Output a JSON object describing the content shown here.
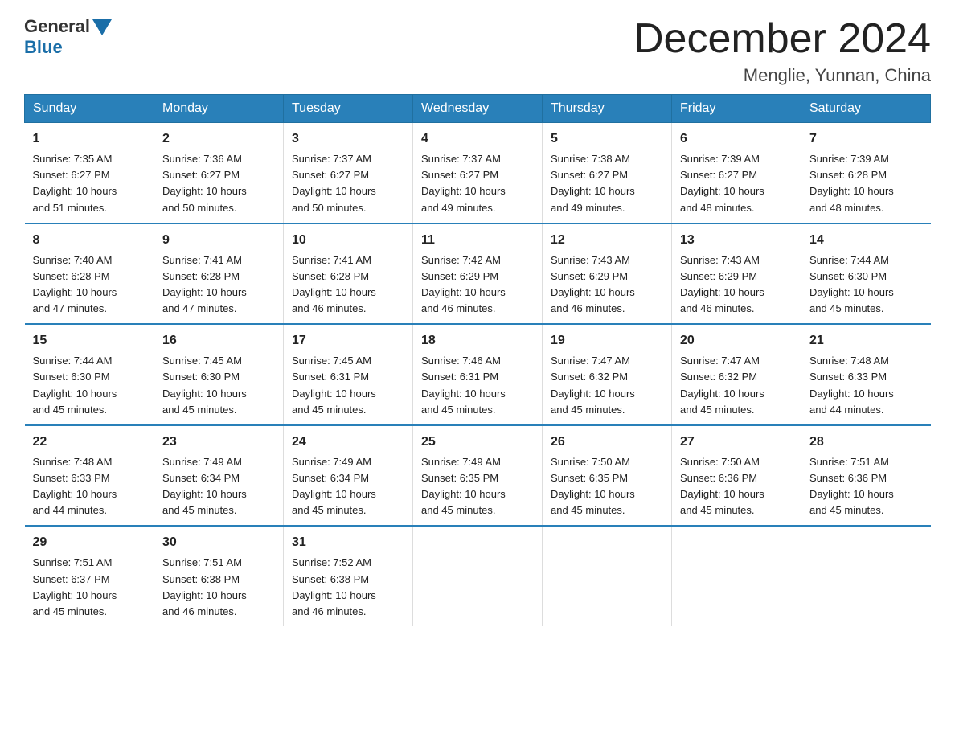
{
  "logo": {
    "general": "General",
    "blue": "Blue"
  },
  "title": "December 2024",
  "location": "Menglie, Yunnan, China",
  "headers": [
    "Sunday",
    "Monday",
    "Tuesday",
    "Wednesday",
    "Thursday",
    "Friday",
    "Saturday"
  ],
  "rows": [
    [
      {
        "day": "1",
        "info": "Sunrise: 7:35 AM\nSunset: 6:27 PM\nDaylight: 10 hours\nand 51 minutes."
      },
      {
        "day": "2",
        "info": "Sunrise: 7:36 AM\nSunset: 6:27 PM\nDaylight: 10 hours\nand 50 minutes."
      },
      {
        "day": "3",
        "info": "Sunrise: 7:37 AM\nSunset: 6:27 PM\nDaylight: 10 hours\nand 50 minutes."
      },
      {
        "day": "4",
        "info": "Sunrise: 7:37 AM\nSunset: 6:27 PM\nDaylight: 10 hours\nand 49 minutes."
      },
      {
        "day": "5",
        "info": "Sunrise: 7:38 AM\nSunset: 6:27 PM\nDaylight: 10 hours\nand 49 minutes."
      },
      {
        "day": "6",
        "info": "Sunrise: 7:39 AM\nSunset: 6:27 PM\nDaylight: 10 hours\nand 48 minutes."
      },
      {
        "day": "7",
        "info": "Sunrise: 7:39 AM\nSunset: 6:28 PM\nDaylight: 10 hours\nand 48 minutes."
      }
    ],
    [
      {
        "day": "8",
        "info": "Sunrise: 7:40 AM\nSunset: 6:28 PM\nDaylight: 10 hours\nand 47 minutes."
      },
      {
        "day": "9",
        "info": "Sunrise: 7:41 AM\nSunset: 6:28 PM\nDaylight: 10 hours\nand 47 minutes."
      },
      {
        "day": "10",
        "info": "Sunrise: 7:41 AM\nSunset: 6:28 PM\nDaylight: 10 hours\nand 46 minutes."
      },
      {
        "day": "11",
        "info": "Sunrise: 7:42 AM\nSunset: 6:29 PM\nDaylight: 10 hours\nand 46 minutes."
      },
      {
        "day": "12",
        "info": "Sunrise: 7:43 AM\nSunset: 6:29 PM\nDaylight: 10 hours\nand 46 minutes."
      },
      {
        "day": "13",
        "info": "Sunrise: 7:43 AM\nSunset: 6:29 PM\nDaylight: 10 hours\nand 46 minutes."
      },
      {
        "day": "14",
        "info": "Sunrise: 7:44 AM\nSunset: 6:30 PM\nDaylight: 10 hours\nand 45 minutes."
      }
    ],
    [
      {
        "day": "15",
        "info": "Sunrise: 7:44 AM\nSunset: 6:30 PM\nDaylight: 10 hours\nand 45 minutes."
      },
      {
        "day": "16",
        "info": "Sunrise: 7:45 AM\nSunset: 6:30 PM\nDaylight: 10 hours\nand 45 minutes."
      },
      {
        "day": "17",
        "info": "Sunrise: 7:45 AM\nSunset: 6:31 PM\nDaylight: 10 hours\nand 45 minutes."
      },
      {
        "day": "18",
        "info": "Sunrise: 7:46 AM\nSunset: 6:31 PM\nDaylight: 10 hours\nand 45 minutes."
      },
      {
        "day": "19",
        "info": "Sunrise: 7:47 AM\nSunset: 6:32 PM\nDaylight: 10 hours\nand 45 minutes."
      },
      {
        "day": "20",
        "info": "Sunrise: 7:47 AM\nSunset: 6:32 PM\nDaylight: 10 hours\nand 45 minutes."
      },
      {
        "day": "21",
        "info": "Sunrise: 7:48 AM\nSunset: 6:33 PM\nDaylight: 10 hours\nand 44 minutes."
      }
    ],
    [
      {
        "day": "22",
        "info": "Sunrise: 7:48 AM\nSunset: 6:33 PM\nDaylight: 10 hours\nand 44 minutes."
      },
      {
        "day": "23",
        "info": "Sunrise: 7:49 AM\nSunset: 6:34 PM\nDaylight: 10 hours\nand 45 minutes."
      },
      {
        "day": "24",
        "info": "Sunrise: 7:49 AM\nSunset: 6:34 PM\nDaylight: 10 hours\nand 45 minutes."
      },
      {
        "day": "25",
        "info": "Sunrise: 7:49 AM\nSunset: 6:35 PM\nDaylight: 10 hours\nand 45 minutes."
      },
      {
        "day": "26",
        "info": "Sunrise: 7:50 AM\nSunset: 6:35 PM\nDaylight: 10 hours\nand 45 minutes."
      },
      {
        "day": "27",
        "info": "Sunrise: 7:50 AM\nSunset: 6:36 PM\nDaylight: 10 hours\nand 45 minutes."
      },
      {
        "day": "28",
        "info": "Sunrise: 7:51 AM\nSunset: 6:36 PM\nDaylight: 10 hours\nand 45 minutes."
      }
    ],
    [
      {
        "day": "29",
        "info": "Sunrise: 7:51 AM\nSunset: 6:37 PM\nDaylight: 10 hours\nand 45 minutes."
      },
      {
        "day": "30",
        "info": "Sunrise: 7:51 AM\nSunset: 6:38 PM\nDaylight: 10 hours\nand 46 minutes."
      },
      {
        "day": "31",
        "info": "Sunrise: 7:52 AM\nSunset: 6:38 PM\nDaylight: 10 hours\nand 46 minutes."
      },
      {
        "day": "",
        "info": ""
      },
      {
        "day": "",
        "info": ""
      },
      {
        "day": "",
        "info": ""
      },
      {
        "day": "",
        "info": ""
      }
    ]
  ]
}
